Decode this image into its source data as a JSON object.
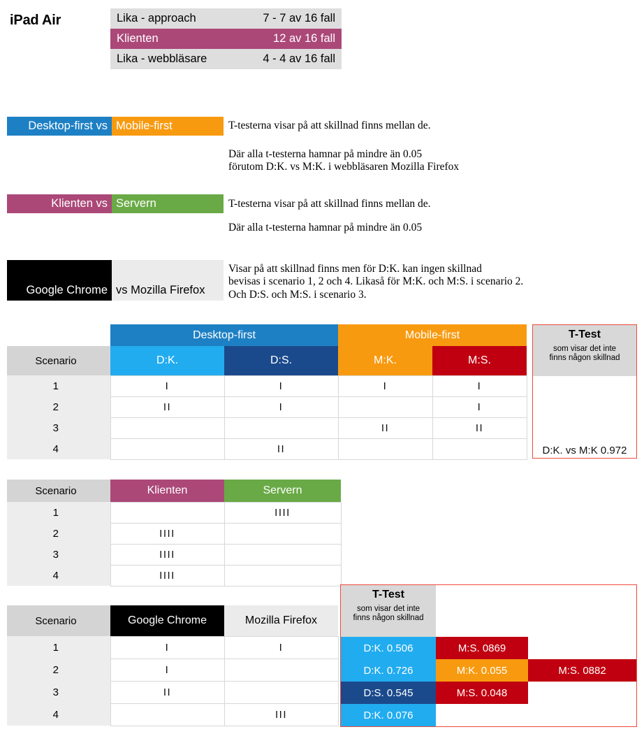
{
  "page": {
    "title": "iPad Air"
  },
  "colors": {
    "desktop_first": "#1e80c4",
    "mobile_first": "#f89a10",
    "dk": "#22acf0",
    "ds": "#1b4a8c",
    "mk": "#f89a10",
    "ms": "#c00010",
    "klienten": "#ab4878",
    "servern": "#69aa46",
    "chrome": "#000000",
    "firefox": "#ebebeb",
    "grey_header": "#d4d4d4",
    "grey_row": "#ededed",
    "grey_strip": "#dedede",
    "ttest_border": "#f04a3c",
    "ttest_head_bg": "#d8d8d8"
  },
  "summary": {
    "rows": [
      {
        "label": "Lika - approach",
        "value": "7 - 7 av 16 fall",
        "style": "plain"
      },
      {
        "label": "Klienten",
        "value": "12 av 16 fall",
        "style": "highlight"
      },
      {
        "label": "Lika - webbläsare",
        "value": "4 - 4 av 16 fall",
        "style": "plain"
      }
    ]
  },
  "comparisons": [
    {
      "left_label": "Desktop-first vs",
      "right_label": "Mobile-first",
      "notes": [
        "T-testerna visar på att skillnad finns mellan de.",
        "Där alla t-testerna hamnar på mindre än 0.05\nförutom D:K. vs M:K. i webbläsaren Mozilla Firefox"
      ]
    },
    {
      "left_label": "Klienten vs",
      "right_label": "Servern",
      "notes": [
        "T-testerna visar på att skillnad finns mellan de.",
        "Där alla t-testerna hamnar på mindre än 0.05"
      ]
    },
    {
      "left_label": "Google Chrome",
      "right_label": "vs Mozilla Firefox",
      "notes": [
        "Visar på att skillnad finns men för D:K. kan ingen skillnad\nbevisas i scenario 1, 2 och 4. Likaså för M:K. och M:S. i scenario 2.\nOch D:S. och M:S. i scenario 3."
      ]
    }
  ],
  "ttest": {
    "title": "T-Test",
    "subtitle": "som visar det inte\nfinns någon skillnad"
  },
  "table_approach": {
    "groups": [
      {
        "label": "Desktop-first"
      },
      {
        "label": "Mobile-first"
      }
    ],
    "scenario_header": "Scenario",
    "columns": [
      "D:K.",
      "D:S.",
      "M:K.",
      "M:S."
    ],
    "rows": [
      {
        "scenario": "1",
        "cells": [
          "I",
          "I",
          "I",
          "I"
        ],
        "ttest": ""
      },
      {
        "scenario": "2",
        "cells": [
          "II",
          "I",
          "",
          "I"
        ],
        "ttest": ""
      },
      {
        "scenario": "3",
        "cells": [
          "",
          "",
          "II",
          "II"
        ],
        "ttest": ""
      },
      {
        "scenario": "4",
        "cells": [
          "",
          "II",
          "",
          ""
        ],
        "ttest": "D:K. vs M:K 0.972"
      }
    ]
  },
  "table_clientserver": {
    "scenario_header": "Scenario",
    "columns": [
      "Klienten",
      "Servern"
    ],
    "rows": [
      {
        "scenario": "1",
        "cells": [
          "",
          "IIII"
        ]
      },
      {
        "scenario": "2",
        "cells": [
          "IIII",
          ""
        ]
      },
      {
        "scenario": "3",
        "cells": [
          "IIII",
          ""
        ]
      },
      {
        "scenario": "4",
        "cells": [
          "IIII",
          ""
        ]
      }
    ]
  },
  "table_browser": {
    "scenario_header": "Scenario",
    "columns": [
      "Google Chrome",
      "Mozilla Firefox"
    ],
    "rows": [
      {
        "scenario": "1",
        "cells": [
          "I",
          "I"
        ],
        "ttests": [
          {
            "text": "D:K. 0.506",
            "color": "#22acf0"
          },
          {
            "text": "M:S. 0869",
            "color": "#c00010"
          }
        ]
      },
      {
        "scenario": "2",
        "cells": [
          "I",
          ""
        ],
        "ttests": [
          {
            "text": "D:K. 0.726",
            "color": "#22acf0"
          },
          {
            "text": "M:K. 0.055",
            "color": "#f89a10"
          },
          {
            "text": "M:S. 0882",
            "color": "#c00010"
          }
        ]
      },
      {
        "scenario": "3",
        "cells": [
          "II",
          ""
        ],
        "ttests": [
          {
            "text": "D:S. 0.545",
            "color": "#1b4a8c"
          },
          {
            "text": "M:S. 0.048",
            "color": "#c00010"
          }
        ]
      },
      {
        "scenario": "4",
        "cells": [
          "",
          "III"
        ],
        "ttests": [
          {
            "text": "D:K. 0.076",
            "color": "#22acf0"
          }
        ]
      }
    ]
  }
}
